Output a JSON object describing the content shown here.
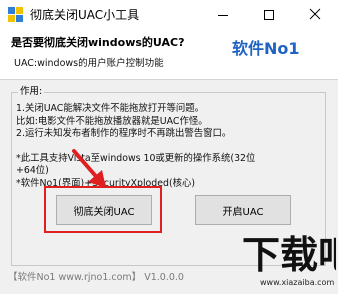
{
  "window": {
    "title": "彻底关闭UAC小工具",
    "minimize_label": "minimize",
    "maximize_label": "maximize",
    "close_label": "close"
  },
  "header": {
    "question": "是否要彻底关闭windows的UAC?",
    "subtitle": "UAC:windows的用户账户控制功能",
    "brand": "软件No1",
    "brand_color": "#1f63c4"
  },
  "group": {
    "legend": "作用:",
    "lines": [
      "1.关闭UAC能解决文件不能拖放打开等问题。",
      "  比如:电影文件不能拖放播放器就是UAC作怪。",
      "2.运行未知发布者制作的程序时不再跳出警告窗口。",
      "",
      "*此工具支持Vista至windows 10或更新的操作系统(32位",
      "+64位)",
      "*软件No1(界面)+SecurityXploded(核心)"
    ]
  },
  "buttons": {
    "disable": "彻底关闭UAC",
    "enable": "开启UAC"
  },
  "footer": {
    "text": "【软件No1 www.rjno1.com】 V1.0.0.0"
  },
  "watermark": {
    "main": "下载吧",
    "url": "www.xiazaiba.com"
  },
  "colors": {
    "highlight": "#e02020",
    "window_bg": "#f0f0f0"
  }
}
